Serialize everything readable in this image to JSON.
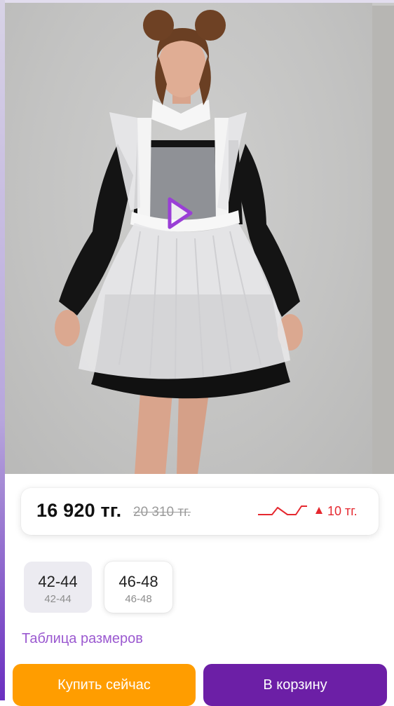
{
  "product_photo": {
    "play_button_icon": "play-icon",
    "accent_color": "#9a3fd6"
  },
  "price": {
    "current": "16 920 тг.",
    "old": "20 310 тг.",
    "delta": "10 тг.",
    "delta_direction": "up",
    "trend_icon": "price-trend-icon",
    "delta_color": "#e5282f"
  },
  "sizes": [
    {
      "label": "42-44",
      "sublabel": "42-44",
      "selected": true
    },
    {
      "label": "46-48",
      "sublabel": "46-48",
      "selected": false
    }
  ],
  "size_table_link": "Таблица размеров",
  "buttons": {
    "buy_now": "Купить сейчас",
    "add_to_cart": "В корзину"
  },
  "colors": {
    "buy_button": "#ff9d00",
    "cart_button": "#6c1fa6",
    "link": "#9b59d0"
  }
}
